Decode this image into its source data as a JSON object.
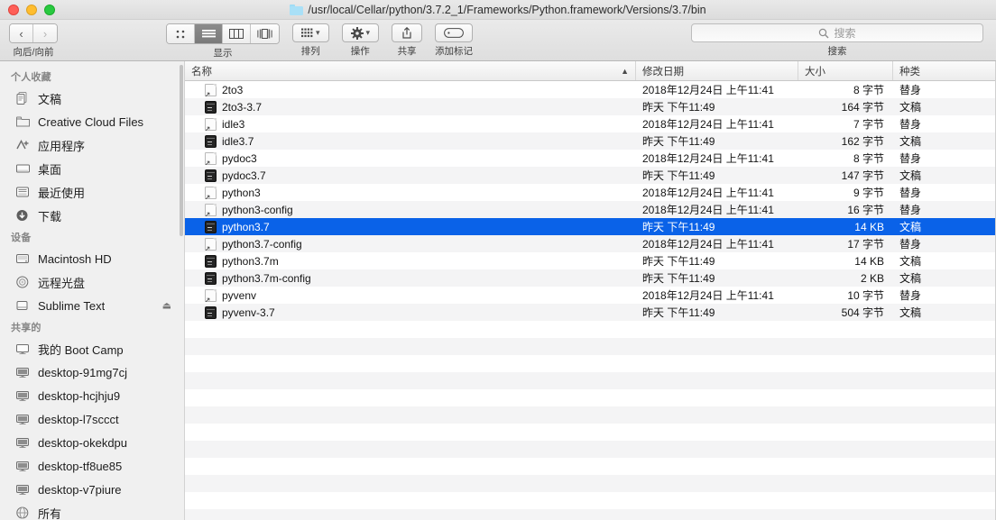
{
  "window": {
    "title_path": "/usr/local/Cellar/python/3.7.2_1/Frameworks/Python.framework/Versions/3.7/bin",
    "folder_icon": "folder-icon",
    "traffic_lights": [
      {
        "name": "close-button",
        "color": "#ff5f57"
      },
      {
        "name": "minimize-button",
        "color": "#ffbd2e"
      },
      {
        "name": "maximize-button",
        "color": "#28c940"
      }
    ]
  },
  "toolbar": {
    "nav_caption": "向后/向前",
    "back_icon": "chevron-left-icon",
    "forward_icon": "chevron-right-icon",
    "view_caption": "显示",
    "view_modes": [
      {
        "name": "icon-view",
        "icon": "grid-icon",
        "active": false
      },
      {
        "name": "list-view",
        "icon": "list-icon",
        "active": true
      },
      {
        "name": "column-view",
        "icon": "columns-icon",
        "active": false
      },
      {
        "name": "gallery-view",
        "icon": "gallery-icon",
        "active": false
      }
    ],
    "arrange_caption": "排列",
    "arrange_icon": "arrange-grid-icon",
    "action_caption": "操作",
    "action_icon": "gear-icon",
    "share_caption": "共享",
    "share_icon": "share-icon",
    "tag_caption": "添加标记",
    "tag_icon": "tag-icon",
    "dropdown_icon": "chevron-down-icon"
  },
  "search": {
    "placeholder": "搜索",
    "caption": "搜索",
    "icon": "search-icon",
    "value": ""
  },
  "sidebar": {
    "sections": [
      {
        "header": "个人收藏",
        "items": [
          {
            "label": "文稿",
            "icon": "documents-icon",
            "eject": false
          },
          {
            "label": "Creative Cloud Files",
            "icon": "folder-icon",
            "eject": false
          },
          {
            "label": "应用程序",
            "icon": "applications-icon",
            "eject": false
          },
          {
            "label": "桌面",
            "icon": "desktop-icon",
            "eject": false
          },
          {
            "label": "最近使用",
            "icon": "recents-icon",
            "eject": false
          },
          {
            "label": "下载",
            "icon": "downloads-icon",
            "eject": false
          }
        ]
      },
      {
        "header": "设备",
        "items": [
          {
            "label": "Macintosh HD",
            "icon": "harddisk-icon",
            "eject": false
          },
          {
            "label": "远程光盘",
            "icon": "disc-icon",
            "eject": false
          },
          {
            "label": "Sublime Text",
            "icon": "volume-icon",
            "eject": true
          }
        ]
      },
      {
        "header": "共享的",
        "items": [
          {
            "label": "我的 Boot Camp",
            "icon": "display-icon",
            "eject": false
          },
          {
            "label": "desktop-91mg7cj",
            "icon": "pc-icon",
            "eject": false
          },
          {
            "label": "desktop-hcjhju9",
            "icon": "pc-icon",
            "eject": false
          },
          {
            "label": "desktop-l7sccct",
            "icon": "pc-icon",
            "eject": false
          },
          {
            "label": "desktop-okekdpu",
            "icon": "pc-icon",
            "eject": false
          },
          {
            "label": "desktop-tf8ue85",
            "icon": "pc-icon",
            "eject": false
          },
          {
            "label": "desktop-v7piure",
            "icon": "pc-icon",
            "eject": false
          },
          {
            "label": "所有",
            "icon": "globe-icon",
            "eject": false
          }
        ]
      }
    ],
    "eject_icon": "eject-icon"
  },
  "filelist": {
    "columns": [
      {
        "key": "name",
        "label": "名称",
        "sorted": true,
        "sort_icon": "chevron-up-icon"
      },
      {
        "key": "date",
        "label": "修改日期",
        "sorted": false
      },
      {
        "key": "size",
        "label": "大小",
        "sorted": false
      },
      {
        "key": "kind",
        "label": "种类",
        "sorted": false
      }
    ],
    "rows": [
      {
        "name": "2to3",
        "icon": "alias-file-icon",
        "date": "2018年12月24日 上午11:41",
        "size": "8 字节",
        "kind": "替身",
        "selected": false
      },
      {
        "name": "2to3-3.7",
        "icon": "unix-exec-icon",
        "date": "昨天 下午11:49",
        "size": "164 字节",
        "kind": "文稿",
        "selected": false
      },
      {
        "name": "idle3",
        "icon": "alias-file-icon",
        "date": "2018年12月24日 上午11:41",
        "size": "7 字节",
        "kind": "替身",
        "selected": false
      },
      {
        "name": "idle3.7",
        "icon": "unix-exec-icon",
        "date": "昨天 下午11:49",
        "size": "162 字节",
        "kind": "文稿",
        "selected": false
      },
      {
        "name": "pydoc3",
        "icon": "alias-file-icon",
        "date": "2018年12月24日 上午11:41",
        "size": "8 字节",
        "kind": "替身",
        "selected": false
      },
      {
        "name": "pydoc3.7",
        "icon": "unix-exec-icon",
        "date": "昨天 下午11:49",
        "size": "147 字节",
        "kind": "文稿",
        "selected": false
      },
      {
        "name": "python3",
        "icon": "alias-file-icon",
        "date": "2018年12月24日 上午11:41",
        "size": "9 字节",
        "kind": "替身",
        "selected": false
      },
      {
        "name": "python3-config",
        "icon": "alias-file-icon",
        "date": "2018年12月24日 上午11:41",
        "size": "16 字节",
        "kind": "替身",
        "selected": false
      },
      {
        "name": "python3.7",
        "icon": "unix-exec-icon",
        "date": "昨天 下午11:49",
        "size": "14 KB",
        "kind": "文稿",
        "selected": true
      },
      {
        "name": "python3.7-config",
        "icon": "alias-file-icon",
        "date": "2018年12月24日 上午11:41",
        "size": "17 字节",
        "kind": "替身",
        "selected": false
      },
      {
        "name": "python3.7m",
        "icon": "unix-exec-icon",
        "date": "昨天 下午11:49",
        "size": "14 KB",
        "kind": "文稿",
        "selected": false
      },
      {
        "name": "python3.7m-config",
        "icon": "unix-exec-icon",
        "date": "昨天 下午11:49",
        "size": "2 KB",
        "kind": "文稿",
        "selected": false
      },
      {
        "name": "pyvenv",
        "icon": "alias-file-icon",
        "date": "2018年12月24日 上午11:41",
        "size": "10 字节",
        "kind": "替身",
        "selected": false
      },
      {
        "name": "pyvenv-3.7",
        "icon": "unix-exec-icon",
        "date": "昨天 下午11:49",
        "size": "504 字节",
        "kind": "文稿",
        "selected": false
      }
    ],
    "empty_row_count": 12
  },
  "colors": {
    "selection": "#0a62e8",
    "sidebar_bg": "#f0f0f0",
    "alt_row": "#f4f4f5"
  }
}
